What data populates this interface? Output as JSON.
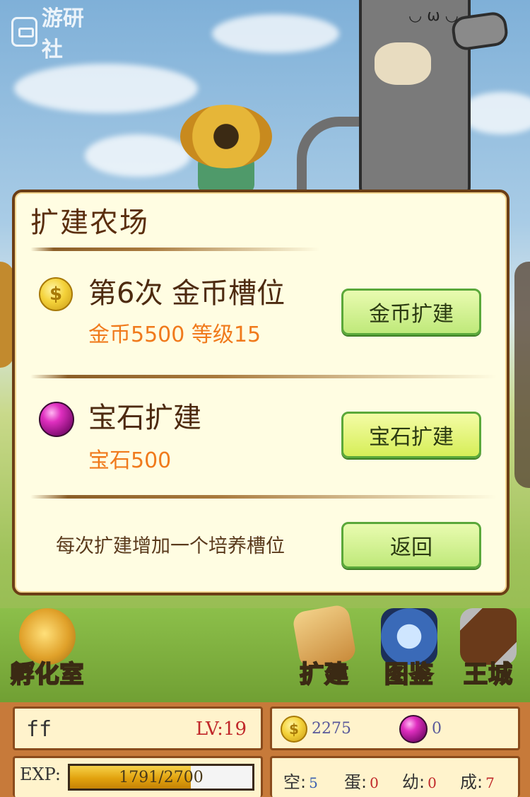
{
  "watermark": {
    "text": "游研社"
  },
  "dialog": {
    "title": "扩建农场",
    "coin_row": {
      "title": "第6次  金币槽位",
      "cost": "金币5500  等级15",
      "button": "金币扩建",
      "icon": "coin-icon"
    },
    "gem_row": {
      "title": "宝石扩建",
      "cost": "宝石500",
      "button": "宝石扩建",
      "icon": "gem-icon"
    },
    "note": "每次扩建增加一个培养槽位",
    "back_button": "返回"
  },
  "menu": {
    "hatchery": "孵化室",
    "expand": "扩建",
    "atlas": "图鉴",
    "castle": "王城"
  },
  "status": {
    "player_name": "ff",
    "level": "LV:19",
    "coins": "2275",
    "gems": "0",
    "exp_label": "EXP:",
    "exp_text": "1791/2700",
    "exp_fraction": 0.663,
    "stats": [
      {
        "label": "空:",
        "value": "5",
        "color": "#3b5fb0"
      },
      {
        "label": "蛋:",
        "value": "0",
        "color": "#c0282a"
      },
      {
        "label": "幼:",
        "value": "0",
        "color": "#c0282a"
      },
      {
        "label": "成:",
        "value": "7",
        "color": "#c0282a"
      }
    ]
  },
  "colors": {
    "dialog_bg": "#fffde2",
    "dialog_border": "#6b3e16",
    "title_text": "#5a2e0e",
    "cost_text": "#f07a1c",
    "button_green": "#bfe97a"
  }
}
